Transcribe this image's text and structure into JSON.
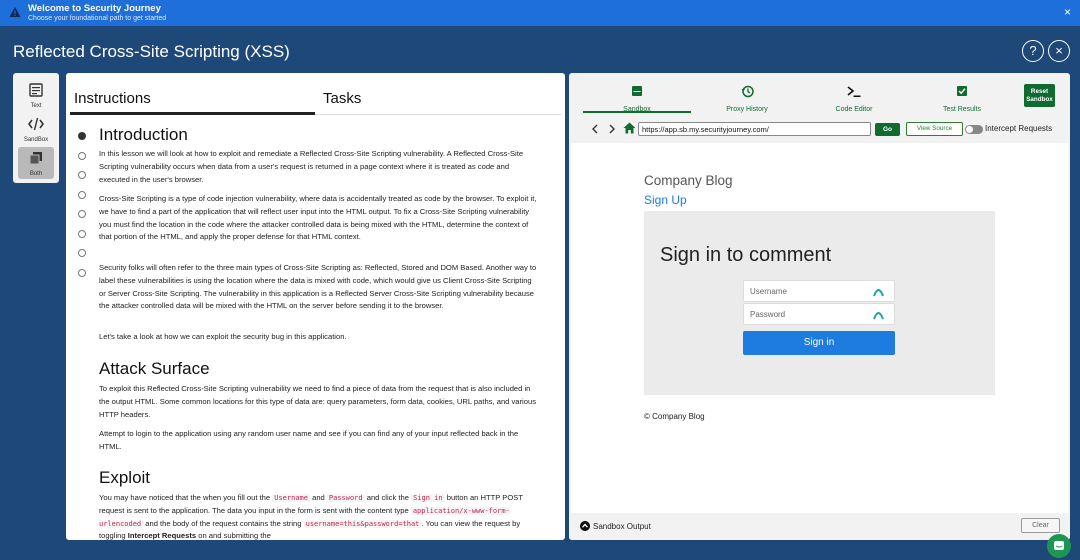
{
  "banner": {
    "title": "Welcome to Security Journey",
    "subtitle": "Choose your foundational path to get started",
    "close": "×"
  },
  "header": {
    "title": "Reflected Cross-Site Scripting (XSS)",
    "help": "?",
    "close": "×"
  },
  "mode_switch": {
    "items": [
      {
        "label": "Text",
        "icon": "text-icon"
      },
      {
        "label": "SandBox",
        "icon": "code-icon"
      },
      {
        "label": "Both",
        "icon": "both-icon",
        "active": true
      }
    ]
  },
  "instructions": {
    "tabs": [
      "Instructions",
      "Tasks"
    ],
    "active_tab": "Instructions",
    "intro": {
      "heading": "Introduction",
      "p1": "In this lesson we will look at how to exploit and remediate a Reflected Cross-Site Scripting vulnerability. A Reflected Cross-Site Scripting vulnerability occurs when data from a user's request is returned in a page context where it is treated as code and executed in the user's browser.",
      "p2": "Cross-Site Scripting is a type of code injection vulnerability, where data is accidentally treated as code by the browser. To exploit it, we have to find a part of the application that will reflect user input into the HTML output. To fix a Cross-Site Scripting vulnerability you must find the location in the code where the attacker controlled data is being mixed with the HTML, determine the context of that portion of the HTML, and apply the proper defense for that HTML context.",
      "p3": "Security folks will often refer to the three main types of Cross-Site Scripting as: Reflected, Stored and DOM Based. Another way to label these vulnerabilities is using the location where the data is mixed with code, which would give us Client Cross-Site Scripting or Server Cross-Site Scripting. The vulnerability in this application is a Reflected Server Cross-Site Scripting vulnerability because the attacker controlled data will be mixed with the HTML on the server before sending it to the browser.",
      "p4": "Let's take a look at how we can exploit the security bug in this application."
    },
    "attack": {
      "heading": "Attack Surface",
      "p1": "To exploit this Reflected Cross-Site Scripting vulnerability we need to find a piece of data from the request that is also included in the output HTML. Some common locations for this type of data are: query parameters, form data, cookies, URL paths, and various HTTP headers.",
      "p2": "Attempt to login to the application using any random user name and see if you can find any of your input reflected back in the HTML."
    },
    "exploit": {
      "heading": "Exploit",
      "t1": "You may have noticed that the when you fill out the",
      "c1": "Username",
      "t2": "and",
      "c2": "Password",
      "t3": "and click the",
      "c3": "Sign in",
      "t4": "button an HTTP POST request is sent to the application. The data you input in the form is sent with the content type",
      "c4": "application/x-www-form-urlencoded",
      "t5": "and the body of the request contains the string",
      "c5": "username=this&password=that",
      "t6": ". You can view the request by toggling",
      "b1": "Intercept Requests",
      "t7": "on and submitting the"
    }
  },
  "sandbox": {
    "tabs": [
      {
        "label": "Sandbox",
        "icon": "sandbox-icon"
      },
      {
        "label": "Proxy History",
        "icon": "history-icon"
      },
      {
        "label": "Code Editor",
        "icon": "terminal-icon"
      },
      {
        "label": "Test Results",
        "icon": "checkbox-icon"
      }
    ],
    "reset_line1": "Reset",
    "reset_line2": "Sandbox",
    "url": "https://app.sb.my.securityjourney.com/",
    "go": "Go",
    "view_source": "View Source",
    "intercept": "Intercept Requests",
    "page": {
      "blog_title": "Company Blog",
      "signup": "Sign Up",
      "form_heading": "Sign in to comment",
      "username_placeholder": "Username",
      "password_placeholder": "Password",
      "signin": "Sign in",
      "footer": "© Company Blog"
    },
    "output_label": "Sandbox Output",
    "clear": "Clear"
  },
  "colors": {
    "background": "#1d4877",
    "banner": "#1e6fd9",
    "accent_green": "#0f6b2f",
    "link_blue": "#1e7be0"
  }
}
